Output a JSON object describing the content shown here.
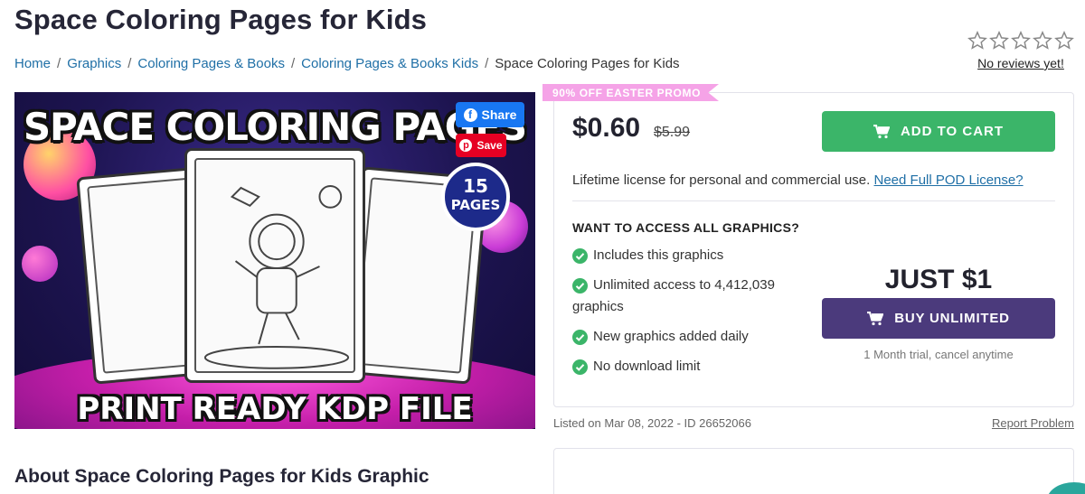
{
  "page": {
    "title": "Space Coloring Pages for Kids"
  },
  "breadcrumb": {
    "items": [
      "Home",
      "Graphics",
      "Coloring Pages & Books",
      "Coloring Pages & Books Kids"
    ],
    "current": "Space Coloring Pages for Kids"
  },
  "rating": {
    "stars_filled": 0,
    "stars_total": 5,
    "no_reviews": "No reviews yet!"
  },
  "image": {
    "title": "SPACE COLORING PAGES",
    "footer": "PRINT READY KDP FILE",
    "badge_number": "15",
    "badge_text": "PAGES"
  },
  "social": {
    "share": "Share",
    "save": "Save"
  },
  "promo": {
    "label": "90% OFF EASTER PROMO"
  },
  "pricing": {
    "price": "$0.60",
    "old_price": "$5.99",
    "add_to_cart": "ADD TO CART",
    "license_text": "Lifetime license for personal and commercial use.",
    "license_link": "Need Full POD License?"
  },
  "unlimited": {
    "heading": "WANT TO ACCESS ALL GRAPHICS?",
    "features": [
      "Includes this graphics",
      "Unlimited access to 4,412,039 graphics",
      "New graphics added daily",
      "No download limit"
    ],
    "price": "JUST $1",
    "button": "BUY UNLIMITED",
    "note": "1 Month trial, cancel anytime"
  },
  "meta": {
    "listed_on": "Listed on Mar 08, 2022 - ID 26652066",
    "report": "Report Problem"
  },
  "about": {
    "heading": "About Space Coloring Pages for Kids Graphic"
  },
  "colors": {
    "cart_green": "#3bb569",
    "unlimited_purple": "#4b3a7c",
    "promo_pink": "#f5a3e7",
    "link_blue": "#1f6fa6"
  }
}
